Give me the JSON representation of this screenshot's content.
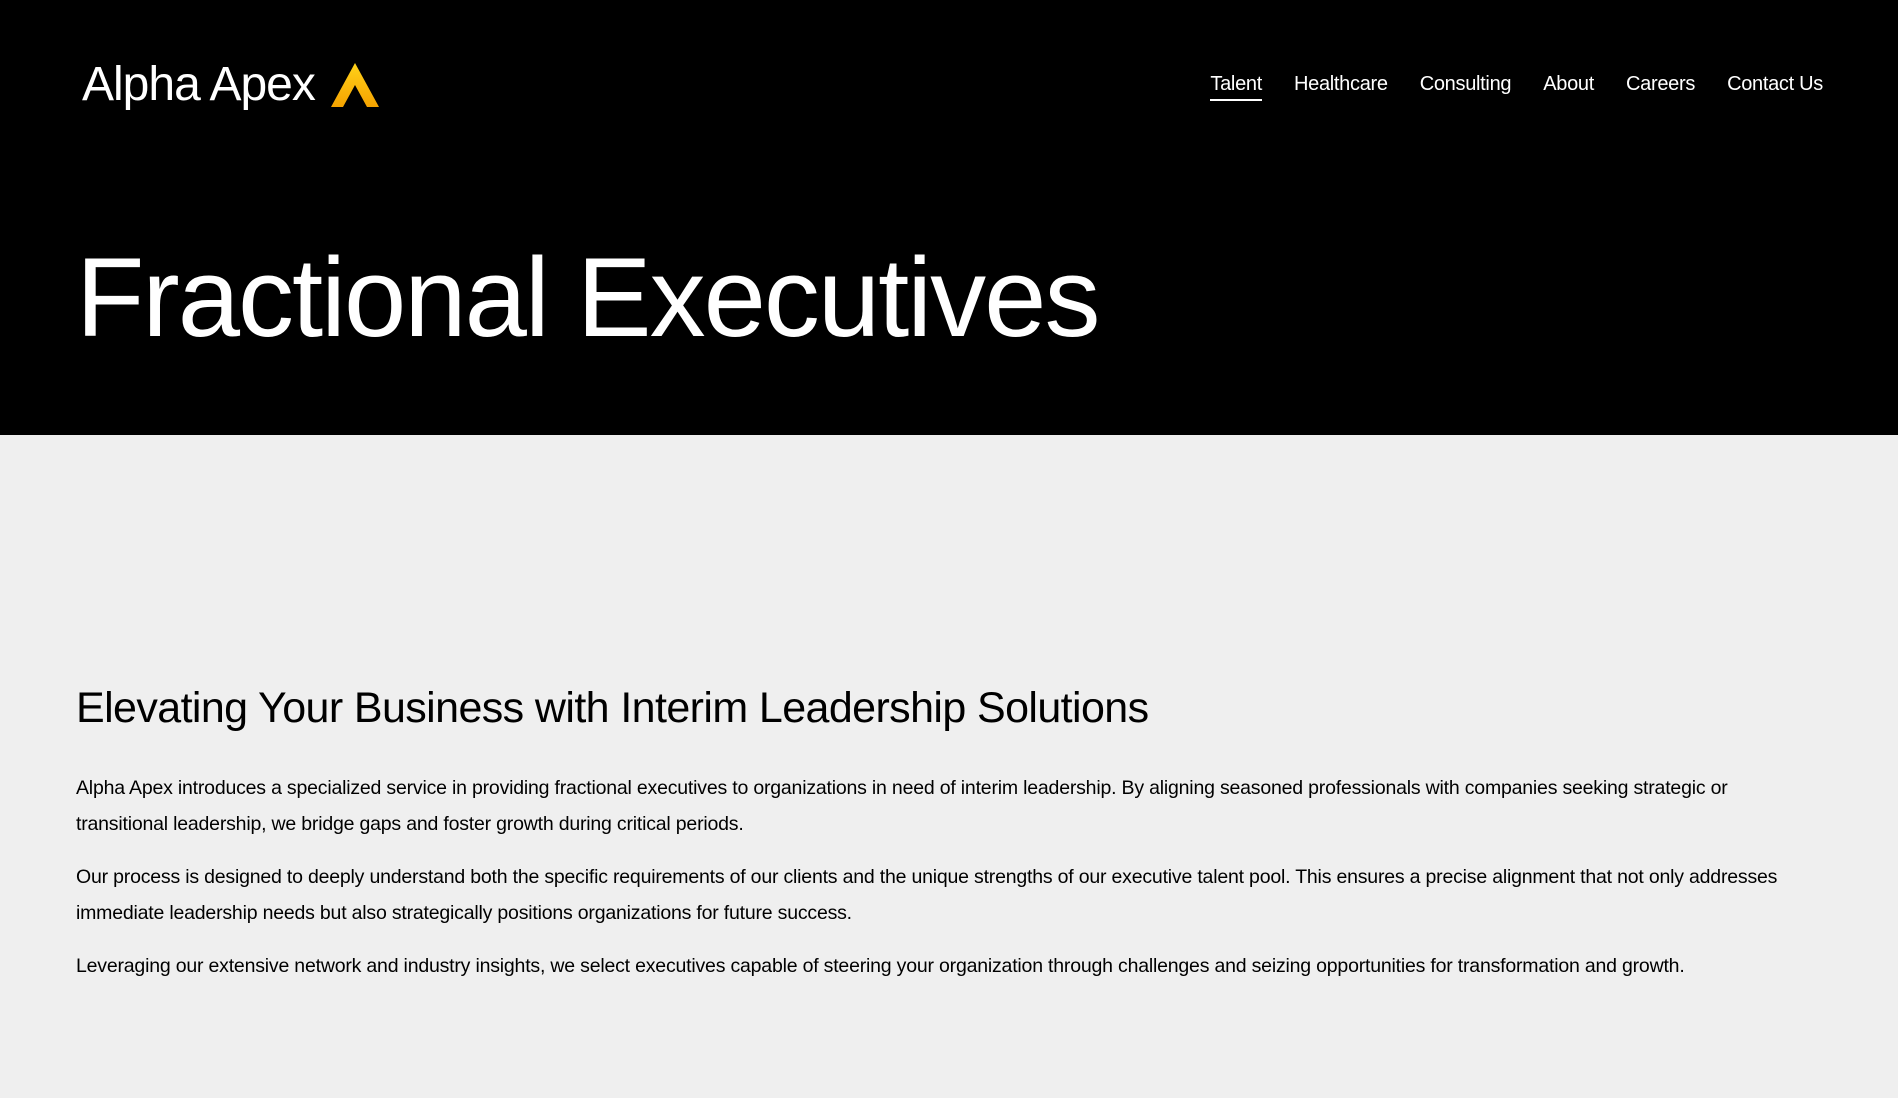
{
  "brand": {
    "name": "Alpha Apex",
    "mark_icon": "apex-triangle-icon",
    "mark_colors": [
      "#ffd21a",
      "#f5a300"
    ]
  },
  "nav": {
    "items": [
      {
        "label": "Talent",
        "active": true
      },
      {
        "label": "Healthcare",
        "active": false
      },
      {
        "label": "Consulting",
        "active": false
      },
      {
        "label": "About",
        "active": false
      },
      {
        "label": "Careers",
        "active": false
      },
      {
        "label": "Contact Us",
        "active": false
      }
    ]
  },
  "hero": {
    "title": "Fractional Executives",
    "background": "#000000"
  },
  "main": {
    "heading": "Elevating Your Business with Interim Leadership Solutions",
    "paragraphs": [
      "Alpha Apex introduces a specialized service in providing fractional executives to organizations in need of interim leadership. By aligning seasoned professionals with companies seeking strategic or transitional leadership, we bridge gaps and foster growth during critical periods.",
      "Our process is designed to deeply understand both the specific requirements of our clients and the unique strengths of our executive talent pool. This ensures a precise alignment that not only addresses immediate leadership needs but also strategically positions organizations for future success.",
      "Leveraging our extensive network and industry insights, we select executives capable of steering your organization through challenges and seizing opportunities for transformation and growth."
    ],
    "background": "#efefef"
  }
}
